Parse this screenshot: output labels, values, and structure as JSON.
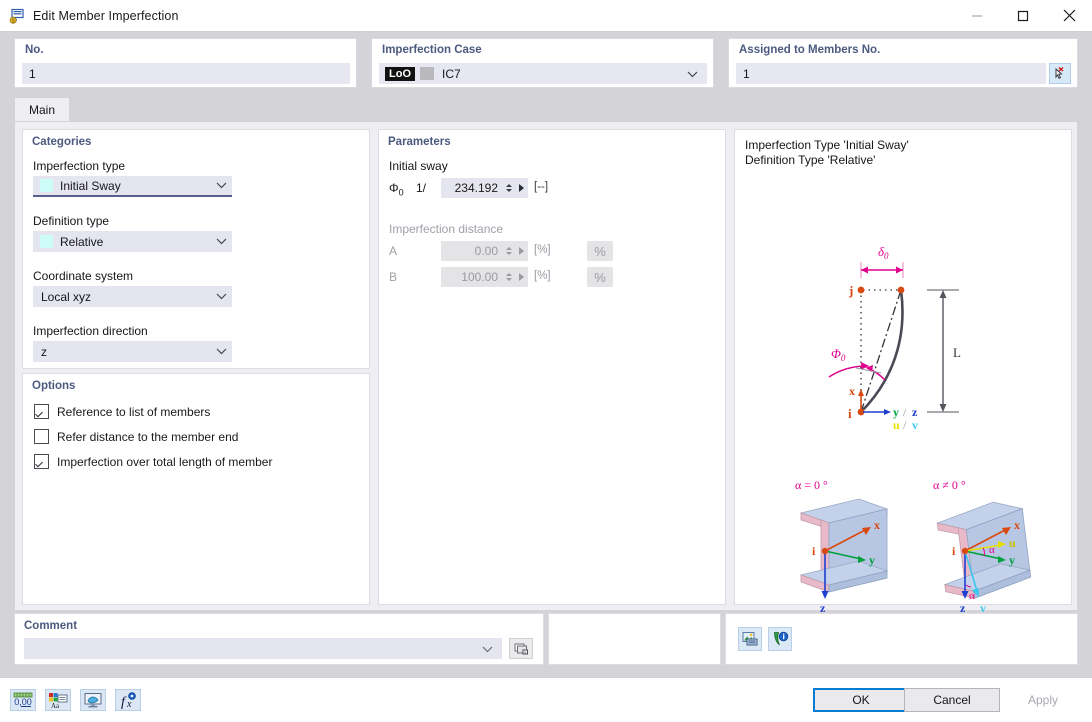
{
  "window": {
    "title": "Edit Member Imperfection",
    "icon": "member-imperfection-icon",
    "minimize_label": "—",
    "maximize_label": "☐",
    "close_label": "✕"
  },
  "header": {
    "no": {
      "title": "No.",
      "value": "1"
    },
    "imperfection_case": {
      "title": "Imperfection Case",
      "tag": "LoO",
      "value": "IC7",
      "arrow": "chevron-down-icon"
    },
    "assigned_members": {
      "title": "Assigned to Members No.",
      "value": "1",
      "pick_button": "pick-members-icon"
    }
  },
  "tabs": [
    {
      "label": "Main",
      "active": true
    }
  ],
  "categories": {
    "title": "Categories",
    "fields": [
      {
        "label": "Imperfection type",
        "value": "Initial Sway",
        "swatch": "#ccfbf8",
        "has_swatch": true,
        "focused": true
      },
      {
        "label": "Definition type",
        "value": "Relative",
        "swatch": "#ccfbf8",
        "has_swatch": true,
        "focused": false
      },
      {
        "label": "Coordinate system",
        "value": "Local xyz",
        "has_swatch": false,
        "focused": false
      },
      {
        "label": "Imperfection direction",
        "value": "z",
        "has_swatch": false,
        "focused": false
      }
    ]
  },
  "options": {
    "title": "Options",
    "items": [
      {
        "label": "Reference to list of members",
        "checked": true
      },
      {
        "label": "Refer distance to the member end",
        "checked": false
      },
      {
        "label": "Imperfection over total length of member",
        "checked": true
      }
    ]
  },
  "parameters": {
    "title": "Parameters",
    "initial_sway": {
      "group_label": "Initial sway",
      "symbol": "Φ",
      "symbol_sub": "0",
      "prefix": "1/",
      "value": "234.192",
      "unit": "[--]",
      "enabled": true
    },
    "imperfection_distance": {
      "group_label": "Imperfection distance",
      "enabled": false,
      "rows": [
        {
          "label": "A",
          "value": "0.00",
          "unit": "[%]",
          "button": "%"
        },
        {
          "label": "B",
          "value": "100.00",
          "unit": "[%]",
          "button": "%"
        }
      ]
    }
  },
  "diagram": {
    "caption_line1": "Imperfection Type 'Initial Sway'",
    "caption_line2": "Definition Type 'Relative'",
    "sway": {
      "delta_label": "δ",
      "delta_sub": "0",
      "phi_label": "Φ",
      "phi_sub": "0",
      "length_label": "L",
      "node_start": "i",
      "node_end": "j",
      "axis_x": "x",
      "axis_yz": "y / z",
      "axis_uv": "u / v"
    },
    "sections": [
      {
        "title": "α = 0 °",
        "labels": {
          "i": "i",
          "x": "x",
          "y": "y",
          "z": "z"
        }
      },
      {
        "title": "α ≠ 0 °",
        "labels": {
          "i": "i",
          "x": "x",
          "y": "y",
          "z": "z",
          "u": "u",
          "v": "v",
          "alpha1": "α",
          "alpha2": "α"
        }
      }
    ],
    "toolbar": [
      {
        "name": "picture-export-icon"
      },
      {
        "name": "info-help-icon"
      }
    ]
  },
  "comment": {
    "title": "Comment",
    "value": "",
    "dropdown_icon": "chevron-down-icon",
    "browse_icon": "comment-library-icon"
  },
  "bottom_toolbar": [
    {
      "name": "decimal-places-icon",
      "label": "0,00"
    },
    {
      "name": "display-properties-icon"
    },
    {
      "name": "view-settings-icon"
    },
    {
      "name": "formula-icon"
    }
  ],
  "dialog_buttons": [
    {
      "label": "OK",
      "state": "primary"
    },
    {
      "label": "Cancel",
      "state": "normal"
    },
    {
      "label": "Apply",
      "state": "disabled"
    }
  ],
  "colors": {
    "accent_blue": "#0a7bd4",
    "group_title": "#4c5a80",
    "field_bg": "#e5e5f0",
    "panel_bg": "#efeff3",
    "window_bg": "#d4d4d8",
    "magenta": "#e0008c",
    "orange": "#d94a12",
    "green": "#00a03c",
    "blue": "#1c3fd0"
  }
}
